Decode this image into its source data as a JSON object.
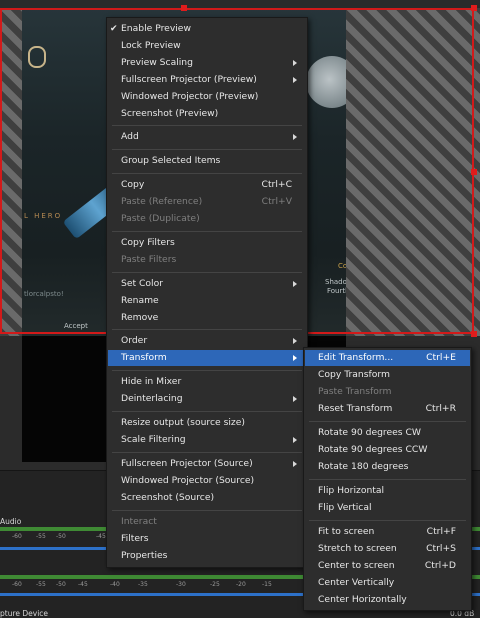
{
  "preview": {
    "game_text": {
      "hero": "L HERO",
      "accept": "Accept",
      "shadow": "Shadow",
      "fourth": "Fourth",
      "co": "Co",
      "tag": "tlorcalpsto!"
    }
  },
  "mixer": {
    "channel_1": "Audio",
    "channel_2": "pture Device",
    "level_2": "0.0 dB",
    "scale_1": [
      "-60",
      "-55",
      "-50",
      "-45",
      "-40",
      "-35",
      "-30",
      "-25",
      "-20",
      "-15"
    ],
    "scale_2": [
      "-60",
      "-55",
      "-50",
      "-45",
      "-40",
      "-35",
      "-30",
      "-25",
      "-20",
      "-15"
    ]
  },
  "context_menu": {
    "items": [
      {
        "label": "Enable Preview",
        "checked": true
      },
      {
        "label": "Lock Preview"
      },
      {
        "label": "Preview Scaling",
        "submenu": true
      },
      {
        "label": "Fullscreen Projector (Preview)",
        "submenu": true
      },
      {
        "label": "Windowed Projector (Preview)"
      },
      {
        "label": "Screenshot (Preview)"
      },
      {
        "label": "Add",
        "submenu": true
      },
      {
        "label": "Group Selected Items"
      },
      {
        "label": "Copy",
        "shortcut": "Ctrl+C"
      },
      {
        "label": "Paste (Reference)",
        "shortcut": "Ctrl+V",
        "disabled": true
      },
      {
        "label": "Paste (Duplicate)",
        "disabled": true
      },
      {
        "label": "Copy Filters"
      },
      {
        "label": "Paste Filters",
        "disabled": true
      },
      {
        "label": "Set Color",
        "submenu": true
      },
      {
        "label": "Rename"
      },
      {
        "label": "Remove"
      },
      {
        "label": "Order",
        "submenu": true
      },
      {
        "label": "Transform",
        "submenu": true,
        "highlighted": true
      },
      {
        "label": "Hide in Mixer"
      },
      {
        "label": "Deinterlacing",
        "submenu": true
      },
      {
        "label": "Resize output (source size)"
      },
      {
        "label": "Scale Filtering",
        "submenu": true
      },
      {
        "label": "Fullscreen Projector (Source)",
        "submenu": true
      },
      {
        "label": "Windowed Projector (Source)"
      },
      {
        "label": "Screenshot (Source)"
      },
      {
        "label": "Interact",
        "disabled": true
      },
      {
        "label": "Filters"
      },
      {
        "label": "Properties"
      }
    ]
  },
  "transform_menu": {
    "items": [
      {
        "label": "Edit Transform...",
        "shortcut": "Ctrl+E",
        "highlighted": true
      },
      {
        "label": "Copy Transform"
      },
      {
        "label": "Paste Transform",
        "disabled": true
      },
      {
        "label": "Reset Transform",
        "shortcut": "Ctrl+R"
      },
      {
        "label": "Rotate 90 degrees CW"
      },
      {
        "label": "Rotate 90 degrees CCW"
      },
      {
        "label": "Rotate 180 degrees"
      },
      {
        "label": "Flip Horizontal"
      },
      {
        "label": "Flip Vertical"
      },
      {
        "label": "Fit to screen",
        "shortcut": "Ctrl+F"
      },
      {
        "label": "Stretch to screen",
        "shortcut": "Ctrl+S"
      },
      {
        "label": "Center to screen",
        "shortcut": "Ctrl+D"
      },
      {
        "label": "Center Vertically"
      },
      {
        "label": "Center Horizontally"
      }
    ]
  },
  "colors": {
    "highlight": "#2d67b8",
    "selection_border": "#d21a1a",
    "meter_green": "#3f8a34",
    "meter_blue": "#2d71c9"
  }
}
